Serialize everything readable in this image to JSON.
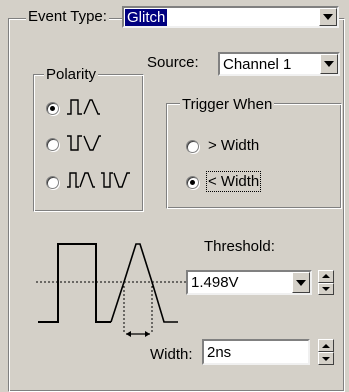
{
  "event_type": {
    "label": "Event Type:",
    "value": "Glitch"
  },
  "source": {
    "label": "Source:",
    "value": "Channel 1"
  },
  "polarity": {
    "title": "Polarity",
    "selected": "positive"
  },
  "trigger_when": {
    "title": "Trigger When",
    "options": [
      "> Width",
      "< Width"
    ],
    "selected": "< Width"
  },
  "threshold": {
    "label": "Threshold:",
    "value": "1.498V"
  },
  "width": {
    "label": "Width:",
    "value": "2ns"
  }
}
